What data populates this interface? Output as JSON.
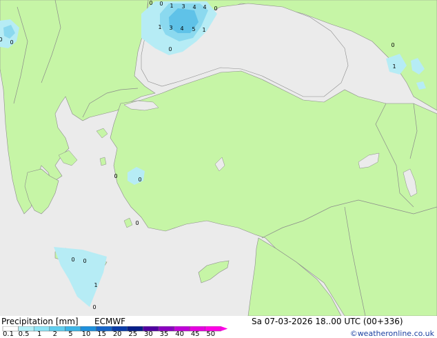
{
  "title_left": "Precipitation [mm]",
  "model": "ECMWF",
  "valid_time": "Sa 07-03-2026 18..00 UTC (00+336)",
  "credit": "©weatheronline.co.uk",
  "legend": {
    "ticks": [
      "0.1",
      "0.5",
      "1",
      "2",
      "5",
      "10",
      "15",
      "20",
      "25",
      "30",
      "35",
      "40",
      "45",
      "50"
    ],
    "colors": [
      "#ffffff",
      "#b3f0f8",
      "#8ee4f6",
      "#60cdee",
      "#3cb4e6",
      "#1e90dc",
      "#1464c8",
      "#0a3ca8",
      "#061e88",
      "#5000a0",
      "#8a00c0",
      "#c000d8",
      "#e600e0",
      "#ff00e6"
    ]
  },
  "colors": {
    "land": "#c6f5a6",
    "sea": "#ebebeb",
    "border": "#8a8a8a",
    "precip_light": "#b6ecf5",
    "precip_mid": "#8bd9ef",
    "precip_heavy": "#5fc2e8"
  },
  "station_values": [
    {
      "label": "0"
    },
    {
      "label": "0"
    },
    {
      "label": "1"
    },
    {
      "label": "3"
    },
    {
      "label": "4"
    },
    {
      "label": "4"
    },
    {
      "label": "0"
    },
    {
      "label": "1"
    },
    {
      "label": "3"
    },
    {
      "label": "4"
    },
    {
      "label": "5"
    },
    {
      "label": "1"
    },
    {
      "label": "0"
    },
    {
      "label": "0"
    },
    {
      "label": "0"
    },
    {
      "label": "0"
    },
    {
      "label": "1"
    },
    {
      "label": "0"
    },
    {
      "label": "0"
    },
    {
      "label": "0"
    },
    {
      "label": "0"
    },
    {
      "label": "0"
    },
    {
      "label": "1"
    },
    {
      "label": "0"
    }
  ]
}
